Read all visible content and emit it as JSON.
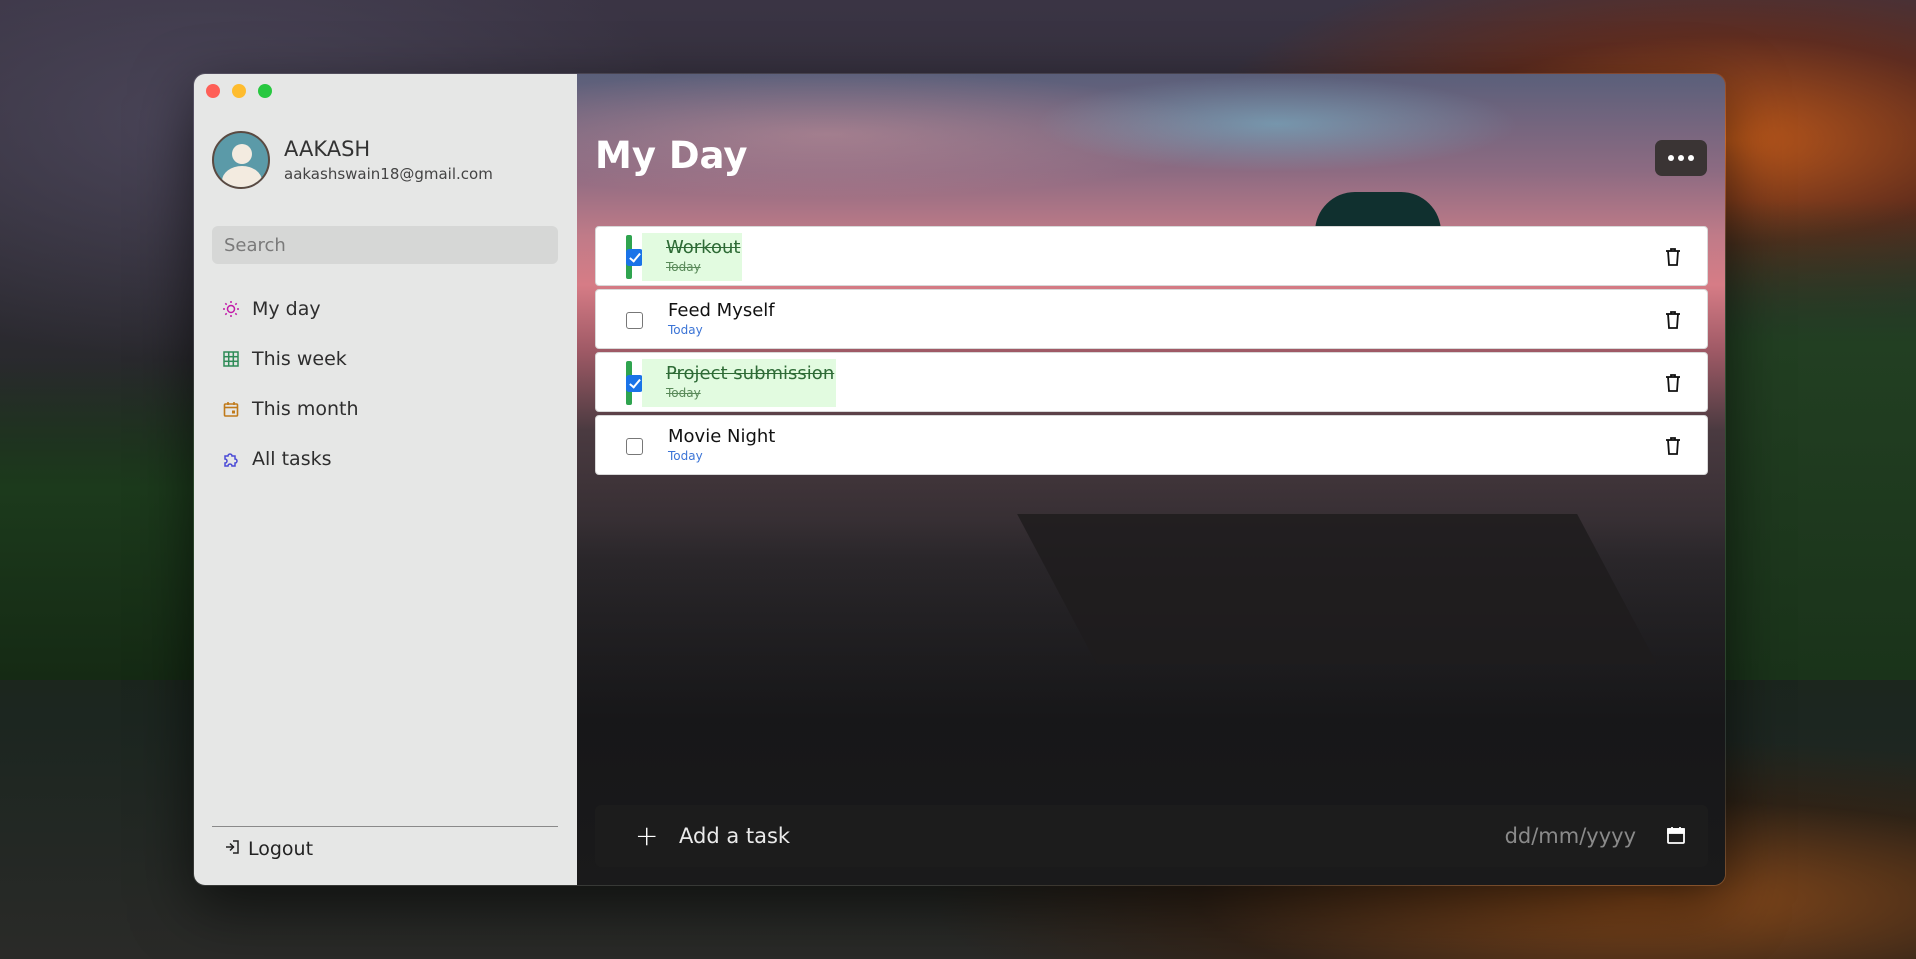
{
  "window": {
    "traffic_lights": [
      "close",
      "minimize",
      "zoom"
    ]
  },
  "sidebar": {
    "profile": {
      "name": "AAKASH",
      "email": "aakashswain18@gmail.com"
    },
    "search": {
      "placeholder": "Search",
      "value": ""
    },
    "items": [
      {
        "label": "My day",
        "icon": "sun-icon",
        "color": "#c21aa8"
      },
      {
        "label": "This week",
        "icon": "grid-icon",
        "color": "#2e8b57"
      },
      {
        "label": "This month",
        "icon": "calendar-icon",
        "color": "#c07a1a"
      },
      {
        "label": "All tasks",
        "icon": "puzzle-icon",
        "color": "#4a4ad6"
      }
    ],
    "logout_label": "Logout"
  },
  "main": {
    "title": "My Day",
    "more_icon": "more-icon",
    "tasks": [
      {
        "name": "Workout",
        "date": "Today",
        "done": true
      },
      {
        "name": "Feed Myself",
        "date": "Today",
        "done": false
      },
      {
        "name": "Project submission",
        "date": "Today",
        "done": true
      },
      {
        "name": "Movie Night",
        "date": "Today",
        "done": false
      }
    ],
    "add_task": {
      "placeholder": "Add a task",
      "date_placeholder": "dd/mm/yyyy"
    }
  }
}
